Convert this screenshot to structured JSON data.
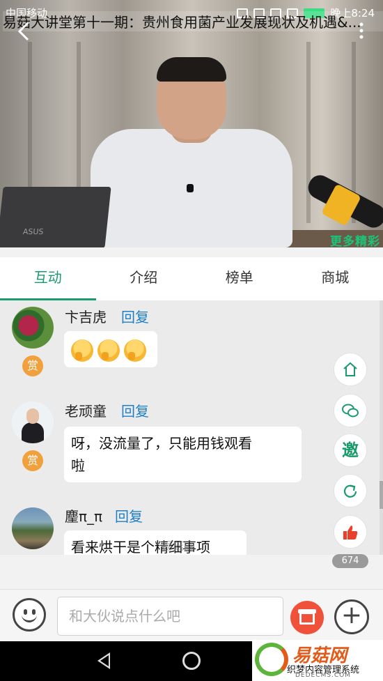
{
  "status_bar": {
    "carrier": "中国移动",
    "time": "晚上8:24"
  },
  "header": {
    "title": "易菇大讲堂第十一期：贵州食用菌产业发展现状及机遇&...",
    "back_icon": "chevron-left-icon",
    "more_icon": "vertical-ellipsis-icon"
  },
  "video": {
    "overlay_text": "更多精彩",
    "laptop_brand": "ASUS"
  },
  "tabs": [
    {
      "label": "互动",
      "active": true
    },
    {
      "label": "介绍",
      "active": false
    },
    {
      "label": "榜单",
      "active": false
    },
    {
      "label": "商城",
      "active": false
    }
  ],
  "messages": [
    {
      "user": "卞吉虎",
      "reply_label": "回复",
      "reward_label": "赏",
      "text": "",
      "emoji_count": 3
    },
    {
      "user": "老顽童",
      "reply_label": "回复",
      "reward_label": "赏",
      "text_line1": "呀，没流量了，只能用钱观看",
      "text_line2": "啦"
    },
    {
      "user": "麈π_π",
      "reply_label": "回复",
      "text": "看来烘干是个精细事项"
    }
  ],
  "floating_actions": {
    "home_icon": "home-icon",
    "wechat_icon": "wechat-icon",
    "invite_label": "邀",
    "refresh_icon": "refresh-icon",
    "like_icon": "thumbs-up-icon",
    "like_count": "674"
  },
  "watermark": "易菇网",
  "input_bar": {
    "placeholder": "和大伙说点什么吧",
    "emoji_icon": "smiley-icon",
    "gift_icon": "gift-icon",
    "plus_icon": "plus-icon"
  },
  "logo": {
    "name": "易菇网",
    "subtitle": "织梦内容管理系统",
    "url": "DEDECMS.COM"
  },
  "colors": {
    "accent": "#1a9a6c",
    "reply_link": "#1f7fc6",
    "reward_badge": "#f0a03c",
    "like_red": "#e8402b",
    "gift_red": "#f0513a"
  }
}
